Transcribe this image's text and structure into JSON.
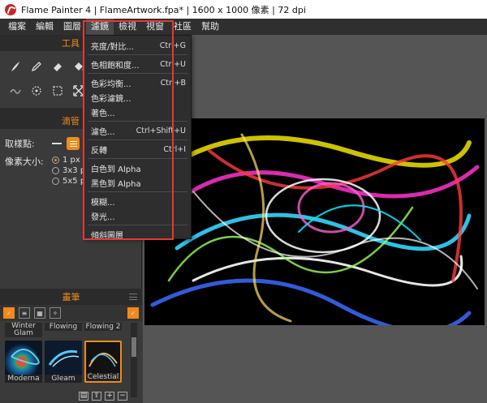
{
  "window": {
    "title": "Flame Painter 4 | FlameArtwork.fpa* | 1600 x 1000 像素 | 72 dpi"
  },
  "menubar": {
    "items": [
      "檔案",
      "編輯",
      "圖層",
      "濾鏡",
      "檢視",
      "視窗",
      "社區",
      "幫助"
    ]
  },
  "tools_panel": {
    "title": "工具"
  },
  "pipe_panel": {
    "title": "滴管",
    "sample_label": "取樣點:",
    "size_label": "像素大小:",
    "size_options": [
      "1 px",
      "3x3 p",
      "5x5 p"
    ]
  },
  "brush_panel": {
    "title": "畫筆",
    "top_row": [
      "Winter Glam",
      "Flowing",
      "Flowing 2"
    ],
    "brushes": [
      "Moderna",
      "Gleam",
      "Celestial"
    ]
  },
  "filter_menu": {
    "items": [
      {
        "label": "亮度/對比...",
        "shortcut": "Ctrl+G"
      },
      {
        "label": "色相飽和度...",
        "shortcut": "Ctrl+U"
      },
      {
        "label": "色彩均衡...",
        "shortcut": "Ctrl+B"
      },
      {
        "label": "色彩濾鏡...",
        "shortcut": ""
      },
      {
        "label": "著色...",
        "shortcut": ""
      },
      {
        "label": "濾色...",
        "shortcut": "Ctrl+Shift+U"
      },
      {
        "label": "反轉",
        "shortcut": "Ctrl+I"
      },
      {
        "label": "白色到 Alpha",
        "shortcut": ""
      },
      {
        "label": "黑色到 Alpha",
        "shortcut": ""
      },
      {
        "label": "模糊...",
        "shortcut": ""
      },
      {
        "label": "發光...",
        "shortcut": ""
      },
      {
        "label": "傾斜圖層",
        "shortcut": ""
      }
    ]
  },
  "colors": {
    "accent": "#f08a1a",
    "highlight_box": "#e53935",
    "canvas_bg": "#000000",
    "workarea_bg": "#555555"
  }
}
